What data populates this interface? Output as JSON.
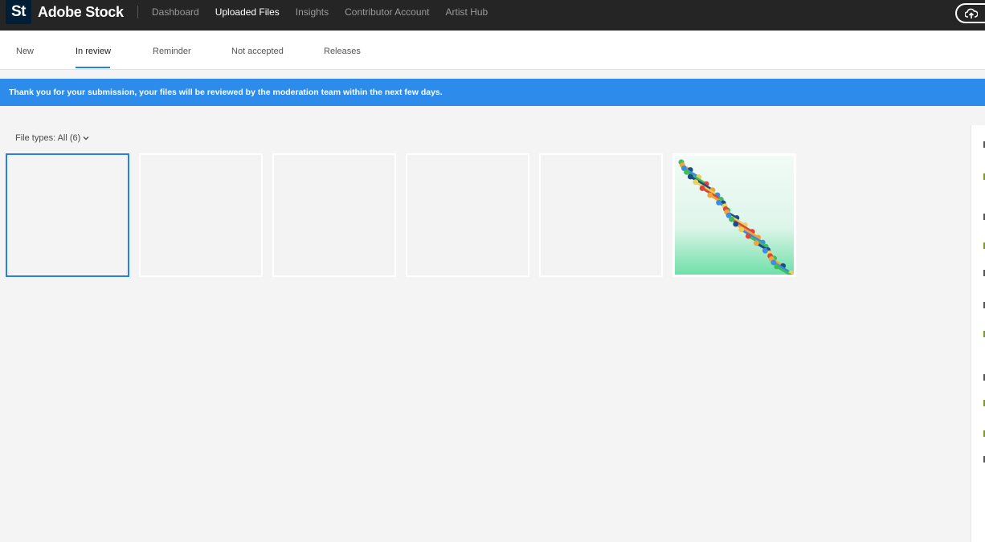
{
  "app": {
    "logo_text": "St",
    "brand": "Adobe Stock"
  },
  "nav": {
    "items": [
      {
        "label": "Dashboard",
        "active": false
      },
      {
        "label": "Uploaded Files",
        "active": true
      },
      {
        "label": "Insights",
        "active": false
      },
      {
        "label": "Contributor Account",
        "active": false
      },
      {
        "label": "Artist Hub",
        "active": false
      }
    ]
  },
  "tabs": {
    "items": [
      {
        "label": "New"
      },
      {
        "label": "In review",
        "active": true
      },
      {
        "label": "Reminder"
      },
      {
        "label": "Not accepted"
      },
      {
        "label": "Releases"
      }
    ]
  },
  "banner": {
    "message": "Thank you for your submission, your files will be reviewed by the moderation team within the next few days."
  },
  "filter": {
    "label": "File types: All (6)"
  },
  "files": {
    "count": 6,
    "thumbnails": [
      "empty",
      "empty",
      "empty",
      "empty",
      "empty",
      "dna-helix-image"
    ]
  },
  "colors": {
    "accent": "#2680eb",
    "banner": "#2d8ceb",
    "topbar": "#252525"
  }
}
